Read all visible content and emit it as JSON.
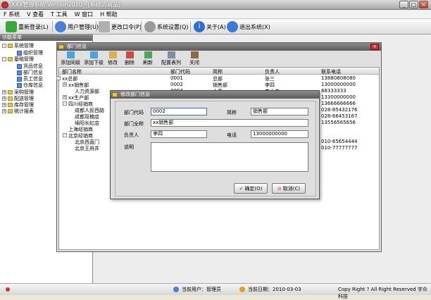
{
  "window": {
    "title": "XXX管理系统 Version2010 - [系统的商品]",
    "min": "_",
    "max": "□",
    "close": "×"
  },
  "menu": [
    "F 系统",
    "V 查看",
    "T 工具",
    "W 窗口",
    "H 帮助"
  ],
  "toolbar": [
    {
      "label": "重新登录(L)",
      "icon": "check-icon",
      "color": "#3aa83a"
    },
    {
      "label": "用户管理(U)",
      "icon": "users-icon",
      "color": "#4a7fd4"
    },
    {
      "label": "更改口令(P)",
      "icon": "key-icon",
      "color": "#b0b0b0"
    },
    {
      "label": "系统设置(Q)",
      "icon": "gear-icon",
      "color": "#9a9a9a"
    },
    {
      "label": "关于(A)",
      "icon": "info-icon",
      "color": "#2f6fcf"
    },
    {
      "label": "退出系统(X)",
      "icon": "exit-icon",
      "color": "#3a7ad8"
    }
  ],
  "nav": {
    "header": "功能菜单",
    "items": [
      {
        "label": "系统管理",
        "level": 0,
        "kind": "folder",
        "sign": "-"
      },
      {
        "label": "组织管理",
        "level": 1,
        "kind": "leaf"
      },
      {
        "label": "基础管理",
        "level": 0,
        "kind": "folder",
        "sign": "-"
      },
      {
        "label": "货品信息",
        "level": 1,
        "kind": "leaf"
      },
      {
        "label": "部门信息",
        "level": 1,
        "kind": "leaf"
      },
      {
        "label": "员工信息",
        "level": 1,
        "kind": "leaf"
      },
      {
        "label": "仓库信息",
        "level": 1,
        "kind": "leaf"
      },
      {
        "label": "采购管理",
        "level": 0,
        "kind": "folder",
        "sign": "+"
      },
      {
        "label": "配送管理",
        "level": 0,
        "kind": "folder",
        "sign": "+"
      },
      {
        "label": "库存管理",
        "level": 0,
        "kind": "folder",
        "sign": "+"
      },
      {
        "label": "统计报表",
        "level": 0,
        "kind": "folder",
        "sign": "+"
      }
    ]
  },
  "child": {
    "title": "部门信息",
    "close": "×",
    "buttons": [
      {
        "label": "添加同级",
        "icon": "add-sibling-icon"
      },
      {
        "label": "添加下级",
        "icon": "add-child-icon"
      },
      {
        "label": "修改",
        "icon": "edit-icon"
      },
      {
        "label": "删除",
        "icon": "delete-icon"
      },
      {
        "label": "刷新",
        "icon": "refresh-icon"
      },
      {
        "label": "配置表列",
        "icon": "columns-icon"
      },
      {
        "label": "关闭",
        "icon": "close-door-icon"
      }
    ],
    "columns": [
      "部门名称",
      "部门代码",
      "简称",
      "负责人",
      "联系电话"
    ],
    "rows": [
      {
        "indent": 0,
        "sign": "-",
        "name": "xx总部",
        "code": "0001",
        "short": "总部",
        "person": "张三",
        "phone": "13880808080"
      },
      {
        "indent": 1,
        "sign": "+",
        "name": "xx销售部",
        "code": "0002",
        "short": "销售部",
        "person": "李四",
        "phone": "13000000000"
      },
      {
        "indent": 2,
        "sign": "",
        "name": "人力资源部",
        "code": "0004",
        "short": "人事",
        "person": "李大中",
        "phone": "88333333"
      },
      {
        "indent": 1,
        "sign": "+",
        "name": "xx生产部",
        "code": "",
        "short": "",
        "person": "",
        "phone": "13300000000"
      },
      {
        "indent": 1,
        "sign": "-",
        "name": "四川经销商",
        "code": "",
        "short": "",
        "person": "",
        "phone": "13666666666"
      },
      {
        "indent": 2,
        "sign": "",
        "name": "成都人民西路",
        "code": "",
        "short": "",
        "person": "",
        "phone": "028-85432176"
      },
      {
        "indent": 2,
        "sign": "",
        "name": "成都双楠店",
        "code": "",
        "short": "",
        "person": "",
        "phone": "028-66453167"
      },
      {
        "indent": 2,
        "sign": "",
        "name": "绵阳长虹店",
        "code": "",
        "short": "",
        "person": "",
        "phone": "13556565656"
      },
      {
        "indent": 1,
        "sign": "",
        "name": "上海经销商",
        "code": "",
        "short": "",
        "person": "",
        "phone": ""
      },
      {
        "indent": 1,
        "sign": "-",
        "name": "北京经销商",
        "code": "",
        "short": "",
        "person": "",
        "phone": ""
      },
      {
        "indent": 2,
        "sign": "",
        "name": "北京西直门",
        "code": "",
        "short": "",
        "person": "",
        "phone": "010-65654444"
      },
      {
        "indent": 2,
        "sign": "",
        "name": "北京王府井",
        "code": "",
        "short": "",
        "person": "",
        "phone": "010-77777777"
      }
    ]
  },
  "dialog": {
    "title": "修改部门信息",
    "code_label": "部门代码",
    "code_value": "0002",
    "short_label": "简称",
    "short_value": "销售部",
    "full_label": "部门全称",
    "full_value": "xx销售部",
    "person_label": "负责人",
    "person_value": "李四",
    "phone_label": "电话",
    "phone_value": "13000000000",
    "desc_label": "说明",
    "desc_value": "",
    "ok_label": "确定(O)",
    "cancel_label": "取消(C)"
  },
  "status": {
    "user_label": "当前用户：管理员",
    "date_label": "当前日期：2010-03-03",
    "copyright": "Copy Right ? All Right Reserved 宇众科技"
  }
}
